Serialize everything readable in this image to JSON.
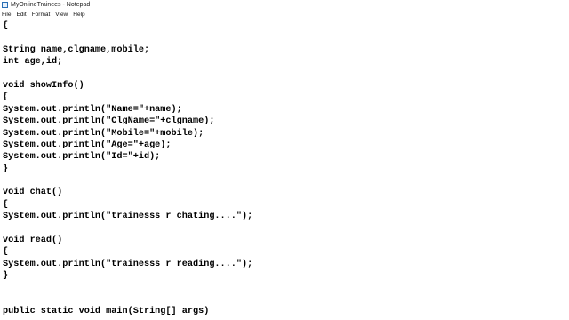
{
  "window": {
    "title": "MyOnlineTrainees - Notepad"
  },
  "menu": [
    {
      "label": "File"
    },
    {
      "label": "Edit"
    },
    {
      "label": "Format"
    },
    {
      "label": "View"
    },
    {
      "label": "Help"
    }
  ],
  "editor": {
    "lines": [
      "{",
      "",
      "String name,clgname,mobile;",
      "int age,id;",
      "",
      "void showInfo()",
      "{",
      "System.out.println(\"Name=\"+name);",
      "System.out.println(\"ClgName=\"+clgname);",
      "System.out.println(\"Mobile=\"+mobile);",
      "System.out.println(\"Age=\"+age);",
      "System.out.println(\"Id=\"+id);",
      "}",
      "",
      "void chat()",
      "{",
      "System.out.println(\"trainesss r chating....\");",
      "",
      "void read()",
      "{",
      "System.out.println(\"trainesss r reading....\");",
      "}",
      "",
      "",
      "public static void main(String[] args)"
    ]
  }
}
